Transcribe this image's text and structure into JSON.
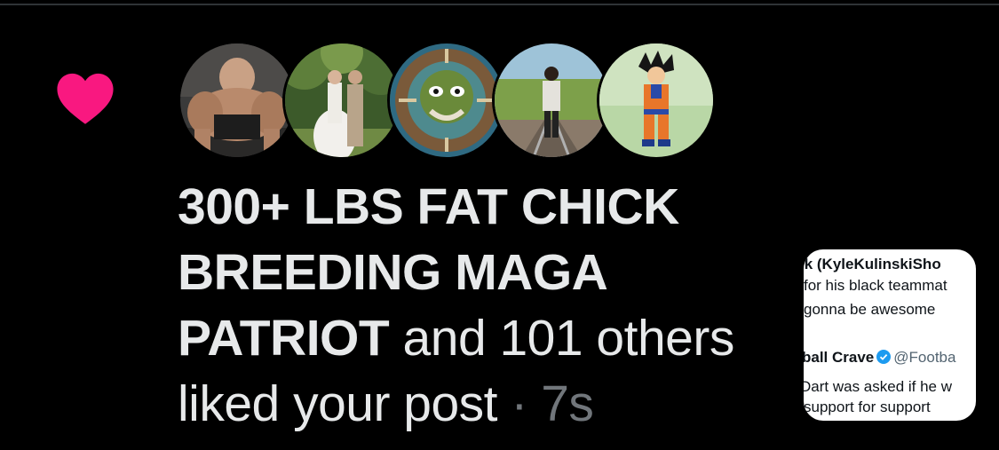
{
  "notification": {
    "type_icon": "heart-icon",
    "like_color": "#f91880",
    "name_text": "300+ LBS FAT CHICK BREEDING MAGA PATRIOT",
    "others_text": " and 101 others liked your post",
    "separator": " · ",
    "time": "7s",
    "avatars": [
      {
        "label": "avatar-muscular-man"
      },
      {
        "label": "avatar-wedding-couple"
      },
      {
        "label": "avatar-illustrated-face"
      },
      {
        "label": "avatar-man-on-tracks"
      },
      {
        "label": "avatar-anime-character"
      }
    ]
  },
  "post_preview": {
    "line1": "ık (KyleKulinskiSho",
    "line2": " for his black teammat",
    "line3": "gonna be awesome",
    "author_name": "ball Crave",
    "author_handle": "@Footba",
    "line5": "Dart was asked if he w",
    "line6": "support for support"
  }
}
